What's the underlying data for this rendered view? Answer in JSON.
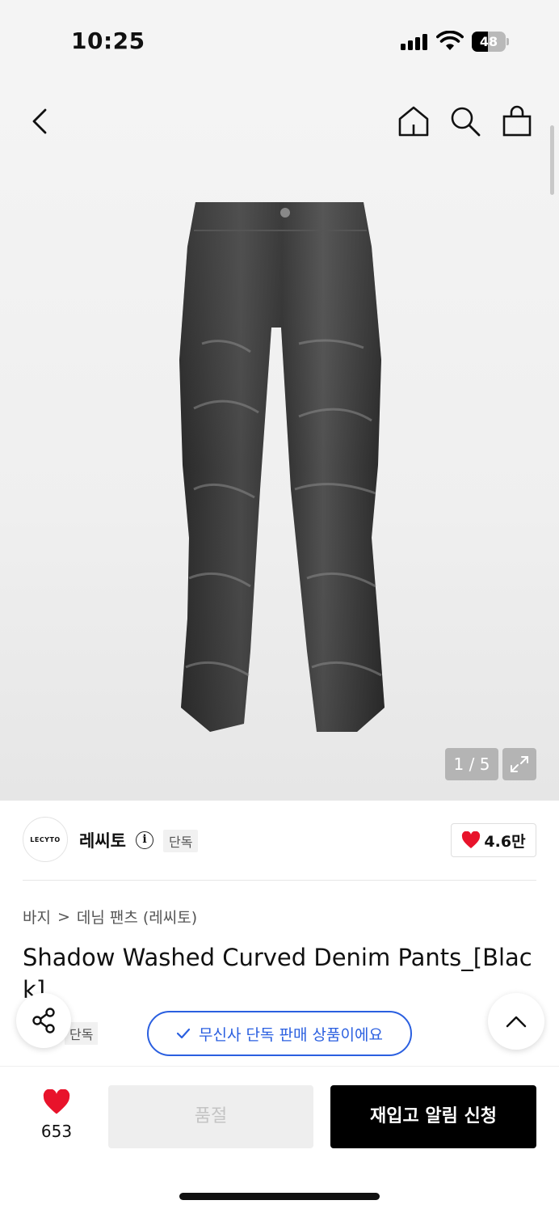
{
  "status_bar": {
    "time": "10:25",
    "battery": "48",
    "battery_level": 0.48
  },
  "nav": {
    "back_icon": "chevron-left-icon",
    "home_icon": "home-icon",
    "search_icon": "search-icon",
    "bag_icon": "shopping-bag-icon"
  },
  "gallery": {
    "counter": "1 / 5",
    "expand_icon": "expand-icon"
  },
  "brand": {
    "logo_text": "LECYTO",
    "name": "레씨토",
    "info": "i",
    "tag": "단독",
    "likes": "4.6만"
  },
  "breadcrumb": {
    "category": "바지",
    "separator": ">",
    "subcategory": "데님 팬츠 (레씨토)"
  },
  "product": {
    "title": "Shadow Washed Curved Denim Pants_[Black]"
  },
  "floating": {
    "tag": "단독",
    "exclusive_banner": "무신사 단독 판매 상품이에요",
    "share_icon": "share-icon",
    "top_icon": "chevron-up-icon"
  },
  "bottom_bar": {
    "heart_count": "653",
    "soldout_label": "품절",
    "restock_label": "재입고 알림 신청"
  },
  "colors": {
    "accent_blue": "#2a5fe0",
    "heart_red": "#e8132b",
    "primary_black": "#000000"
  }
}
